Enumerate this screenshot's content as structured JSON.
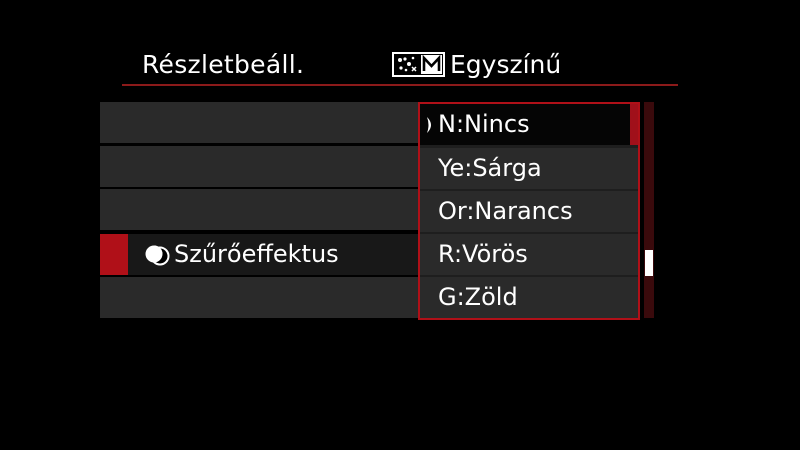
{
  "header": {
    "title": "Részletbeáll.",
    "mode_icon": "creative-mode-m-icon",
    "mode_label": "Egyszínű"
  },
  "menu": {
    "rows": [
      {
        "label": ""
      },
      {
        "label": ""
      },
      {
        "label": ""
      },
      {
        "label": "Szűrőeffektus",
        "icon": "filter-effect-icon",
        "selected": true
      },
      {
        "label": ""
      }
    ]
  },
  "dropdown": {
    "options": [
      {
        "label": "N:Nincs",
        "active": true
      },
      {
        "label": "Ye:Sárga",
        "active": false
      },
      {
        "label": "Or:Narancs",
        "active": false
      },
      {
        "label": "R:Vörös",
        "active": false
      },
      {
        "label": "G:Zöld",
        "active": false
      }
    ]
  },
  "colors": {
    "accent": "#b01018",
    "row_bg": "#2a2a2a",
    "background": "#000000",
    "text": "#ffffff"
  }
}
